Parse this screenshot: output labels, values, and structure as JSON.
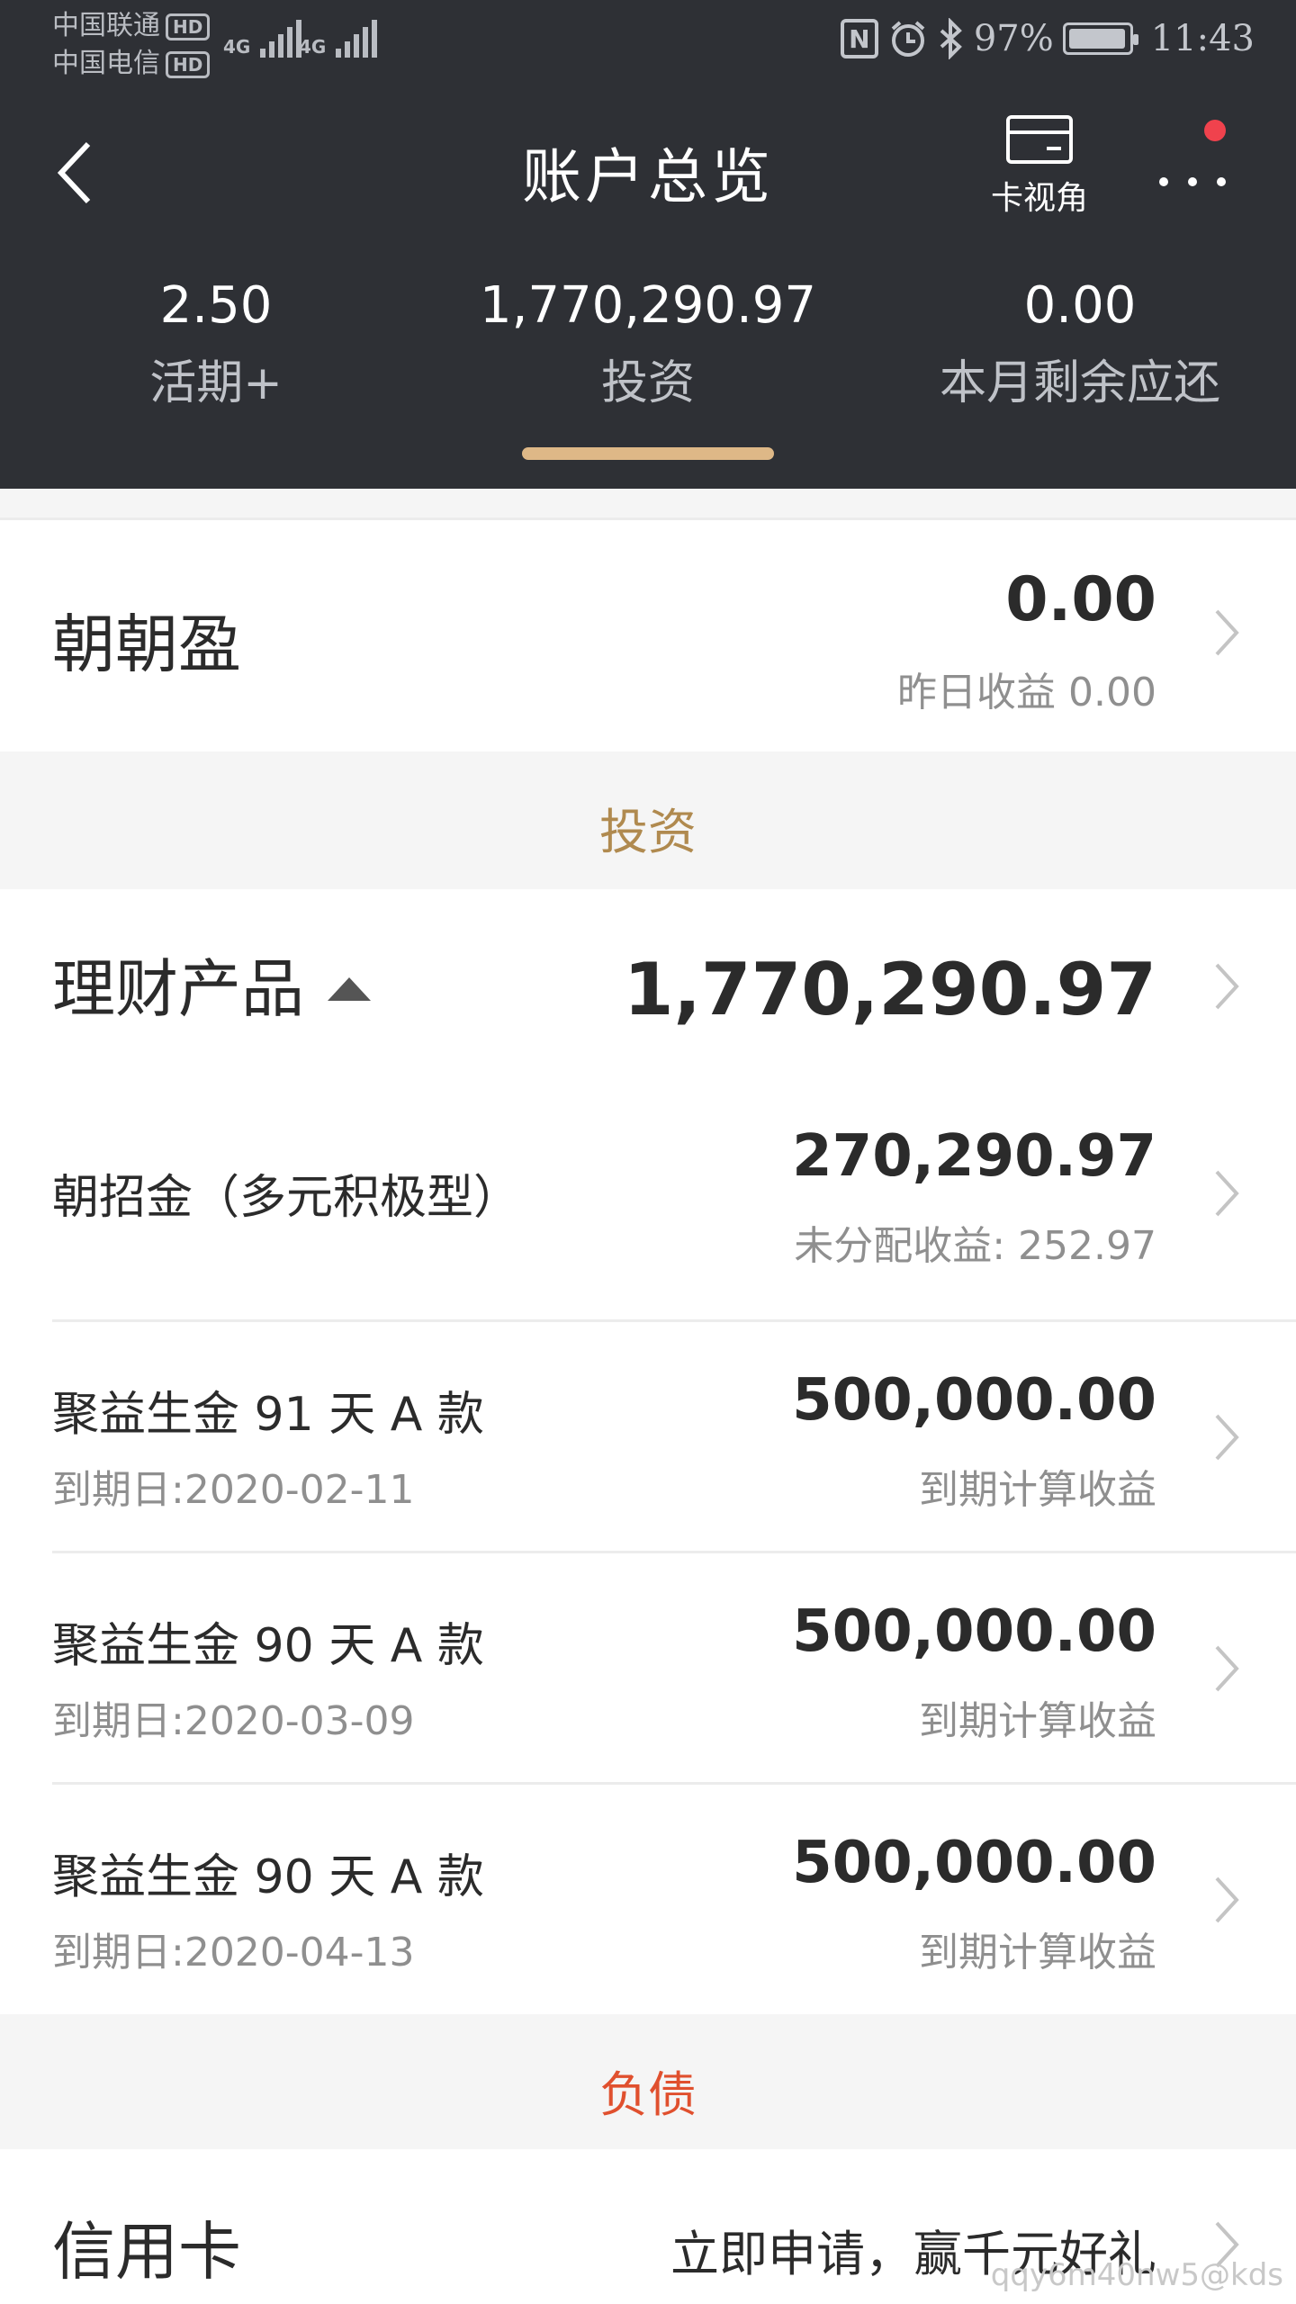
{
  "status_bar": {
    "carrier1": "中国联通",
    "carrier2": "中国电信",
    "hd1": "HD",
    "hd2": "HD",
    "net1": "4G",
    "net2": "4G",
    "nfc": "N",
    "battery": "97%",
    "battery_level": 0.97,
    "time": "11:43"
  },
  "nav": {
    "title": "账户总览",
    "card_view_label": "卡视角"
  },
  "summary": [
    {
      "value": "2.50",
      "label": "活期+"
    },
    {
      "value": "1,770,290.97",
      "label": "投资"
    },
    {
      "value": "0.00",
      "label": "本月剩余应还"
    }
  ],
  "zhaozhaoying": {
    "name": "朝朝盈",
    "amount": "0.00",
    "yesterday": "昨日收益 0.00"
  },
  "invest_section": {
    "label": "投资",
    "color": "#b08a4f"
  },
  "wealth": {
    "name": "理财产品",
    "total": "1,770,290.97",
    "items": [
      {
        "name": "朝招金（多元积极型）",
        "amount": "270,290.97",
        "note": "未分配收益: 252.97"
      },
      {
        "name": "聚益生金 91 天 A 款",
        "due": "到期日:2020-02-11",
        "amount": "500,000.00",
        "note": "到期计算收益"
      },
      {
        "name": "聚益生金 90 天 A 款",
        "due": "到期日:2020-03-09",
        "amount": "500,000.00",
        "note": "到期计算收益"
      },
      {
        "name": "聚益生金 90 天 A 款",
        "due": "到期日:2020-04-13",
        "amount": "500,000.00",
        "note": "到期计算收益"
      }
    ]
  },
  "liability_section": {
    "label": "负债",
    "color": "#e0502e"
  },
  "credit_card": {
    "name": "信用卡",
    "promo": "立即申请，赢千元好礼"
  },
  "watermark": "qqy6m40nw5@kds",
  "colors": {
    "header_bg": "#2e3035",
    "accent_gold": "#deb887",
    "notification_red": "#f0424d"
  }
}
